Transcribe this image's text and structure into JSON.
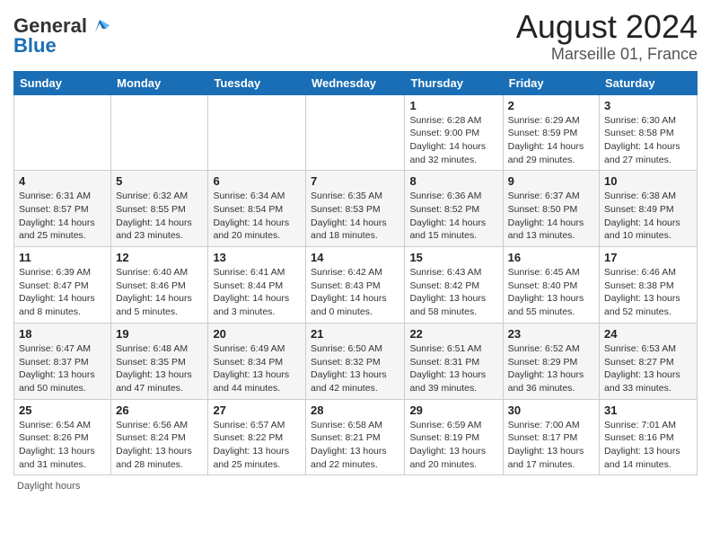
{
  "header": {
    "logo_general": "General",
    "logo_blue": "Blue",
    "title": "August 2024",
    "subtitle": "Marseille 01, France"
  },
  "days_of_week": [
    "Sunday",
    "Monday",
    "Tuesday",
    "Wednesday",
    "Thursday",
    "Friday",
    "Saturday"
  ],
  "footer": {
    "daylight_label": "Daylight hours"
  },
  "weeks": [
    {
      "days": [
        {
          "date": "",
          "info": ""
        },
        {
          "date": "",
          "info": ""
        },
        {
          "date": "",
          "info": ""
        },
        {
          "date": "",
          "info": ""
        },
        {
          "date": "1",
          "info": "Sunrise: 6:28 AM\nSunset: 9:00 PM\nDaylight: 14 hours\nand 32 minutes."
        },
        {
          "date": "2",
          "info": "Sunrise: 6:29 AM\nSunset: 8:59 PM\nDaylight: 14 hours\nand 29 minutes."
        },
        {
          "date": "3",
          "info": "Sunrise: 6:30 AM\nSunset: 8:58 PM\nDaylight: 14 hours\nand 27 minutes."
        }
      ]
    },
    {
      "days": [
        {
          "date": "4",
          "info": "Sunrise: 6:31 AM\nSunset: 8:57 PM\nDaylight: 14 hours\nand 25 minutes."
        },
        {
          "date": "5",
          "info": "Sunrise: 6:32 AM\nSunset: 8:55 PM\nDaylight: 14 hours\nand 23 minutes."
        },
        {
          "date": "6",
          "info": "Sunrise: 6:34 AM\nSunset: 8:54 PM\nDaylight: 14 hours\nand 20 minutes."
        },
        {
          "date": "7",
          "info": "Sunrise: 6:35 AM\nSunset: 8:53 PM\nDaylight: 14 hours\nand 18 minutes."
        },
        {
          "date": "8",
          "info": "Sunrise: 6:36 AM\nSunset: 8:52 PM\nDaylight: 14 hours\nand 15 minutes."
        },
        {
          "date": "9",
          "info": "Sunrise: 6:37 AM\nSunset: 8:50 PM\nDaylight: 14 hours\nand 13 minutes."
        },
        {
          "date": "10",
          "info": "Sunrise: 6:38 AM\nSunset: 8:49 PM\nDaylight: 14 hours\nand 10 minutes."
        }
      ]
    },
    {
      "days": [
        {
          "date": "11",
          "info": "Sunrise: 6:39 AM\nSunset: 8:47 PM\nDaylight: 14 hours\nand 8 minutes."
        },
        {
          "date": "12",
          "info": "Sunrise: 6:40 AM\nSunset: 8:46 PM\nDaylight: 14 hours\nand 5 minutes."
        },
        {
          "date": "13",
          "info": "Sunrise: 6:41 AM\nSunset: 8:44 PM\nDaylight: 14 hours\nand 3 minutes."
        },
        {
          "date": "14",
          "info": "Sunrise: 6:42 AM\nSunset: 8:43 PM\nDaylight: 14 hours\nand 0 minutes."
        },
        {
          "date": "15",
          "info": "Sunrise: 6:43 AM\nSunset: 8:42 PM\nDaylight: 13 hours\nand 58 minutes."
        },
        {
          "date": "16",
          "info": "Sunrise: 6:45 AM\nSunset: 8:40 PM\nDaylight: 13 hours\nand 55 minutes."
        },
        {
          "date": "17",
          "info": "Sunrise: 6:46 AM\nSunset: 8:38 PM\nDaylight: 13 hours\nand 52 minutes."
        }
      ]
    },
    {
      "days": [
        {
          "date": "18",
          "info": "Sunrise: 6:47 AM\nSunset: 8:37 PM\nDaylight: 13 hours\nand 50 minutes."
        },
        {
          "date": "19",
          "info": "Sunrise: 6:48 AM\nSunset: 8:35 PM\nDaylight: 13 hours\nand 47 minutes."
        },
        {
          "date": "20",
          "info": "Sunrise: 6:49 AM\nSunset: 8:34 PM\nDaylight: 13 hours\nand 44 minutes."
        },
        {
          "date": "21",
          "info": "Sunrise: 6:50 AM\nSunset: 8:32 PM\nDaylight: 13 hours\nand 42 minutes."
        },
        {
          "date": "22",
          "info": "Sunrise: 6:51 AM\nSunset: 8:31 PM\nDaylight: 13 hours\nand 39 minutes."
        },
        {
          "date": "23",
          "info": "Sunrise: 6:52 AM\nSunset: 8:29 PM\nDaylight: 13 hours\nand 36 minutes."
        },
        {
          "date": "24",
          "info": "Sunrise: 6:53 AM\nSunset: 8:27 PM\nDaylight: 13 hours\nand 33 minutes."
        }
      ]
    },
    {
      "days": [
        {
          "date": "25",
          "info": "Sunrise: 6:54 AM\nSunset: 8:26 PM\nDaylight: 13 hours\nand 31 minutes."
        },
        {
          "date": "26",
          "info": "Sunrise: 6:56 AM\nSunset: 8:24 PM\nDaylight: 13 hours\nand 28 minutes."
        },
        {
          "date": "27",
          "info": "Sunrise: 6:57 AM\nSunset: 8:22 PM\nDaylight: 13 hours\nand 25 minutes."
        },
        {
          "date": "28",
          "info": "Sunrise: 6:58 AM\nSunset: 8:21 PM\nDaylight: 13 hours\nand 22 minutes."
        },
        {
          "date": "29",
          "info": "Sunrise: 6:59 AM\nSunset: 8:19 PM\nDaylight: 13 hours\nand 20 minutes."
        },
        {
          "date": "30",
          "info": "Sunrise: 7:00 AM\nSunset: 8:17 PM\nDaylight: 13 hours\nand 17 minutes."
        },
        {
          "date": "31",
          "info": "Sunrise: 7:01 AM\nSunset: 8:16 PM\nDaylight: 13 hours\nand 14 minutes."
        }
      ]
    }
  ]
}
